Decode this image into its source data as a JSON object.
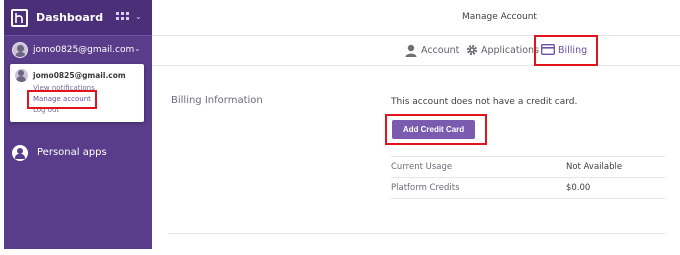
{
  "sidebar": {
    "title": "Dashboard",
    "account_email": "jomo0825@gmail.com",
    "personal_apps_label": "Personal apps",
    "icons": {
      "logo": "heroku-logo-icon",
      "grid": "apps-grid-icon",
      "chevron": "chevron-down-icon",
      "avatar": "user-avatar-icon",
      "personal": "person-circle-icon"
    }
  },
  "dropdown": {
    "email": "jomo0825@gmail.com",
    "view_notifications": "View notifications",
    "manage_account": "Manage account",
    "log_out": "Log out"
  },
  "header": {
    "title": "Manage Account"
  },
  "tabs": [
    {
      "label": "Account",
      "icon": "person-icon"
    },
    {
      "label": "Applications",
      "icon": "gear-icon"
    },
    {
      "label": "Billing",
      "icon": "credit-card-icon",
      "active": true
    }
  ],
  "billing": {
    "section_title": "Billing Information",
    "no_card_message": "This account does not have a credit card.",
    "add_card_button": "Add Credit Card",
    "rows": [
      {
        "label": "Current Usage",
        "value": "Not Available"
      },
      {
        "label": "Platform Credits",
        "value": "$0.00"
      }
    ]
  },
  "colors": {
    "sidebar": "#5a3d8a",
    "accent": "#7a5bb0",
    "highlight": "#e0141c"
  }
}
